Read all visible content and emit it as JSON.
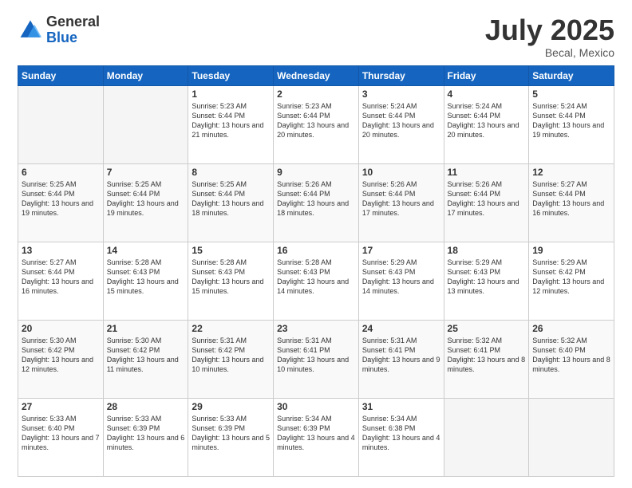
{
  "logo": {
    "general": "General",
    "blue": "Blue"
  },
  "header": {
    "month": "July 2025",
    "location": "Becal, Mexico"
  },
  "weekdays": [
    "Sunday",
    "Monday",
    "Tuesday",
    "Wednesday",
    "Thursday",
    "Friday",
    "Saturday"
  ],
  "weeks": [
    [
      {
        "day": "",
        "sunrise": "",
        "sunset": "",
        "daylight": ""
      },
      {
        "day": "",
        "sunrise": "",
        "sunset": "",
        "daylight": ""
      },
      {
        "day": "1",
        "sunrise": "Sunrise: 5:23 AM",
        "sunset": "Sunset: 6:44 PM",
        "daylight": "Daylight: 13 hours and 21 minutes."
      },
      {
        "day": "2",
        "sunrise": "Sunrise: 5:23 AM",
        "sunset": "Sunset: 6:44 PM",
        "daylight": "Daylight: 13 hours and 20 minutes."
      },
      {
        "day": "3",
        "sunrise": "Sunrise: 5:24 AM",
        "sunset": "Sunset: 6:44 PM",
        "daylight": "Daylight: 13 hours and 20 minutes."
      },
      {
        "day": "4",
        "sunrise": "Sunrise: 5:24 AM",
        "sunset": "Sunset: 6:44 PM",
        "daylight": "Daylight: 13 hours and 20 minutes."
      },
      {
        "day": "5",
        "sunrise": "Sunrise: 5:24 AM",
        "sunset": "Sunset: 6:44 PM",
        "daylight": "Daylight: 13 hours and 19 minutes."
      }
    ],
    [
      {
        "day": "6",
        "sunrise": "Sunrise: 5:25 AM",
        "sunset": "Sunset: 6:44 PM",
        "daylight": "Daylight: 13 hours and 19 minutes."
      },
      {
        "day": "7",
        "sunrise": "Sunrise: 5:25 AM",
        "sunset": "Sunset: 6:44 PM",
        "daylight": "Daylight: 13 hours and 19 minutes."
      },
      {
        "day": "8",
        "sunrise": "Sunrise: 5:25 AM",
        "sunset": "Sunset: 6:44 PM",
        "daylight": "Daylight: 13 hours and 18 minutes."
      },
      {
        "day": "9",
        "sunrise": "Sunrise: 5:26 AM",
        "sunset": "Sunset: 6:44 PM",
        "daylight": "Daylight: 13 hours and 18 minutes."
      },
      {
        "day": "10",
        "sunrise": "Sunrise: 5:26 AM",
        "sunset": "Sunset: 6:44 PM",
        "daylight": "Daylight: 13 hours and 17 minutes."
      },
      {
        "day": "11",
        "sunrise": "Sunrise: 5:26 AM",
        "sunset": "Sunset: 6:44 PM",
        "daylight": "Daylight: 13 hours and 17 minutes."
      },
      {
        "day": "12",
        "sunrise": "Sunrise: 5:27 AM",
        "sunset": "Sunset: 6:44 PM",
        "daylight": "Daylight: 13 hours and 16 minutes."
      }
    ],
    [
      {
        "day": "13",
        "sunrise": "Sunrise: 5:27 AM",
        "sunset": "Sunset: 6:44 PM",
        "daylight": "Daylight: 13 hours and 16 minutes."
      },
      {
        "day": "14",
        "sunrise": "Sunrise: 5:28 AM",
        "sunset": "Sunset: 6:43 PM",
        "daylight": "Daylight: 13 hours and 15 minutes."
      },
      {
        "day": "15",
        "sunrise": "Sunrise: 5:28 AM",
        "sunset": "Sunset: 6:43 PM",
        "daylight": "Daylight: 13 hours and 15 minutes."
      },
      {
        "day": "16",
        "sunrise": "Sunrise: 5:28 AM",
        "sunset": "Sunset: 6:43 PM",
        "daylight": "Daylight: 13 hours and 14 minutes."
      },
      {
        "day": "17",
        "sunrise": "Sunrise: 5:29 AM",
        "sunset": "Sunset: 6:43 PM",
        "daylight": "Daylight: 13 hours and 14 minutes."
      },
      {
        "day": "18",
        "sunrise": "Sunrise: 5:29 AM",
        "sunset": "Sunset: 6:43 PM",
        "daylight": "Daylight: 13 hours and 13 minutes."
      },
      {
        "day": "19",
        "sunrise": "Sunrise: 5:29 AM",
        "sunset": "Sunset: 6:42 PM",
        "daylight": "Daylight: 13 hours and 12 minutes."
      }
    ],
    [
      {
        "day": "20",
        "sunrise": "Sunrise: 5:30 AM",
        "sunset": "Sunset: 6:42 PM",
        "daylight": "Daylight: 13 hours and 12 minutes."
      },
      {
        "day": "21",
        "sunrise": "Sunrise: 5:30 AM",
        "sunset": "Sunset: 6:42 PM",
        "daylight": "Daylight: 13 hours and 11 minutes."
      },
      {
        "day": "22",
        "sunrise": "Sunrise: 5:31 AM",
        "sunset": "Sunset: 6:42 PM",
        "daylight": "Daylight: 13 hours and 10 minutes."
      },
      {
        "day": "23",
        "sunrise": "Sunrise: 5:31 AM",
        "sunset": "Sunset: 6:41 PM",
        "daylight": "Daylight: 13 hours and 10 minutes."
      },
      {
        "day": "24",
        "sunrise": "Sunrise: 5:31 AM",
        "sunset": "Sunset: 6:41 PM",
        "daylight": "Daylight: 13 hours and 9 minutes."
      },
      {
        "day": "25",
        "sunrise": "Sunrise: 5:32 AM",
        "sunset": "Sunset: 6:41 PM",
        "daylight": "Daylight: 13 hours and 8 minutes."
      },
      {
        "day": "26",
        "sunrise": "Sunrise: 5:32 AM",
        "sunset": "Sunset: 6:40 PM",
        "daylight": "Daylight: 13 hours and 8 minutes."
      }
    ],
    [
      {
        "day": "27",
        "sunrise": "Sunrise: 5:33 AM",
        "sunset": "Sunset: 6:40 PM",
        "daylight": "Daylight: 13 hours and 7 minutes."
      },
      {
        "day": "28",
        "sunrise": "Sunrise: 5:33 AM",
        "sunset": "Sunset: 6:39 PM",
        "daylight": "Daylight: 13 hours and 6 minutes."
      },
      {
        "day": "29",
        "sunrise": "Sunrise: 5:33 AM",
        "sunset": "Sunset: 6:39 PM",
        "daylight": "Daylight: 13 hours and 5 minutes."
      },
      {
        "day": "30",
        "sunrise": "Sunrise: 5:34 AM",
        "sunset": "Sunset: 6:39 PM",
        "daylight": "Daylight: 13 hours and 4 minutes."
      },
      {
        "day": "31",
        "sunrise": "Sunrise: 5:34 AM",
        "sunset": "Sunset: 6:38 PM",
        "daylight": "Daylight: 13 hours and 4 minutes."
      },
      {
        "day": "",
        "sunrise": "",
        "sunset": "",
        "daylight": ""
      },
      {
        "day": "",
        "sunrise": "",
        "sunset": "",
        "daylight": ""
      }
    ]
  ]
}
